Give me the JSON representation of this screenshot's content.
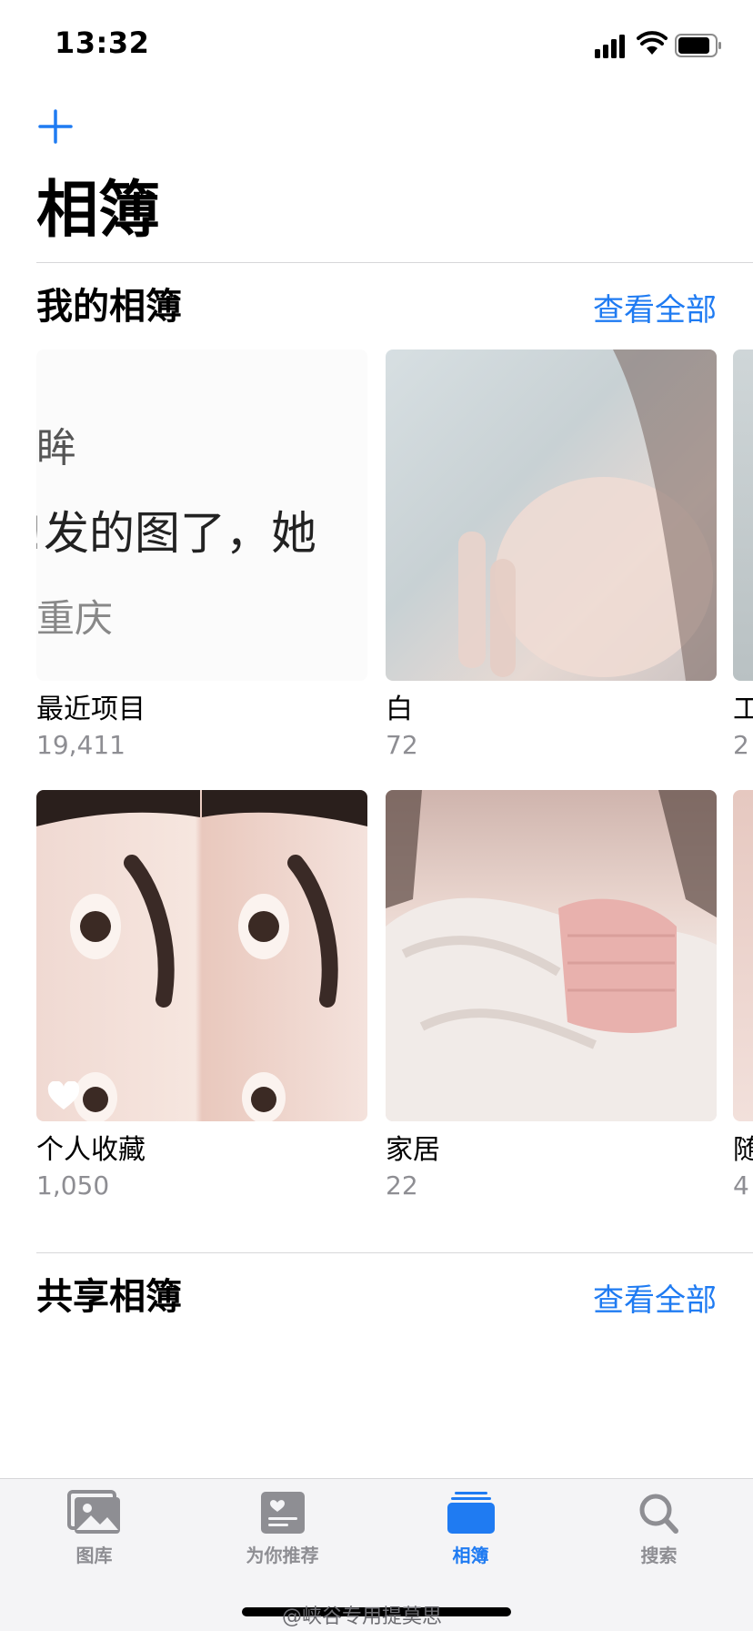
{
  "status_bar": {
    "time": "13:32"
  },
  "header": {
    "title": "相簿"
  },
  "my_albums": {
    "title": "我的相簿",
    "see_all": "查看全部",
    "recent_preview": [
      "眸",
      "!发的图了，她",
      "重庆"
    ],
    "albums": [
      {
        "name": "最近项目",
        "count": "19,411"
      },
      {
        "name": "白",
        "count": "72"
      },
      {
        "name": "工",
        "count": "2"
      },
      {
        "name": "个人收藏",
        "count": "1,050"
      },
      {
        "name": "家居",
        "count": "22"
      },
      {
        "name": "随",
        "count": "4"
      }
    ]
  },
  "shared_albums": {
    "title": "共享相簿",
    "see_all": "查看全部"
  },
  "tab_bar": {
    "tabs": [
      {
        "label": "图库",
        "icon": "photos-icon"
      },
      {
        "label": "为你推荐",
        "icon": "for-you-icon"
      },
      {
        "label": "相簿",
        "icon": "albums-icon"
      },
      {
        "label": "搜索",
        "icon": "search-icon"
      }
    ],
    "active_index": 2
  },
  "watermark": "@峡谷专用提莫思",
  "colors": {
    "accent": "#1f7bf2",
    "secondary_text": "#8e8e93"
  }
}
